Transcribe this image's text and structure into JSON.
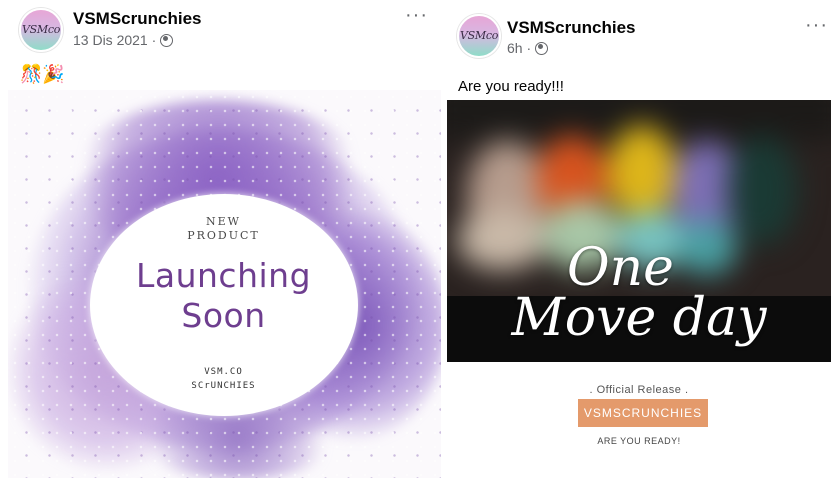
{
  "post_left": {
    "page_name": "VSMScrunchies",
    "avatar_text": "VSMco",
    "date": "13 Dis 2021 ·",
    "more": "···",
    "caption": "🎊🎉",
    "image": {
      "line1": "NEW",
      "line2": "PRODUCT",
      "headline1": "Launching",
      "headline2": "Soon",
      "brand1": "VSM.CO",
      "brand2": "SCrUNCHIES"
    }
  },
  "post_right": {
    "page_name": "VSMScrunchies",
    "avatar_text": "VSMco",
    "time": "6h ·",
    "more": "···",
    "caption": "Are you ready!!!",
    "image": {
      "script1": "One",
      "script2": "Move day"
    },
    "official_release": ". Official Release .",
    "brand_label": "VSMSCRUNCHIES",
    "ready_label": "ARE YOU READY!"
  },
  "colors": {
    "name_text": "#050505",
    "meta_text": "#65676b",
    "headline_purple": "#6e3e8f",
    "brand_orange": "#e49a6b"
  },
  "icons": [
    "globe-icon",
    "more-options-icon"
  ]
}
